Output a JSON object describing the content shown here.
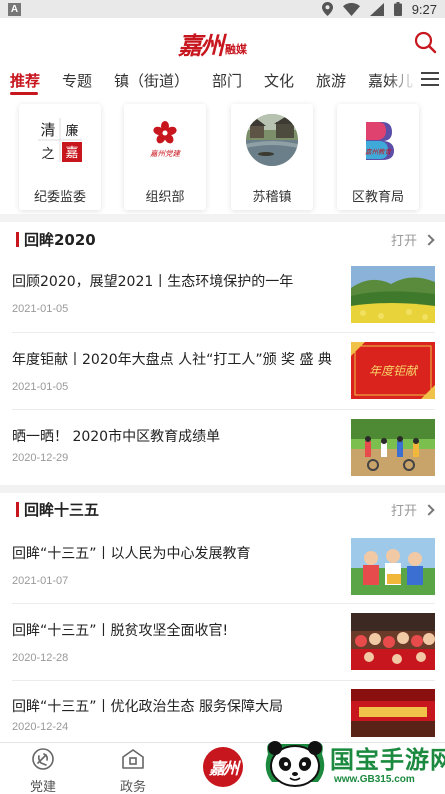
{
  "status_bar": {
    "notification_letter": "A",
    "time": "9:27"
  },
  "header": {
    "logo_text": "嘉州",
    "logo_sub": "融媒"
  },
  "tabs": [
    "推荐",
    "专题",
    "镇（街道）",
    "部门",
    "文化",
    "旅游",
    "嘉妹儿"
  ],
  "shortcuts": [
    {
      "label": "纪委监委",
      "icon_text": [
        "清",
        "廉",
        "之",
        "嘉"
      ]
    },
    {
      "label": "组织部",
      "icon_text": "嘉州党建"
    },
    {
      "label": "苏稽镇"
    },
    {
      "label": "区教育局",
      "icon_text": "嘉州教育"
    }
  ],
  "sections": [
    {
      "title": "回眸2020",
      "open_label": "打开",
      "articles": [
        {
          "title": "回顾2020，展望2021丨生态环境保护的一年",
          "date": "2021-01-05",
          "thumb": "landscape-thumb"
        },
        {
          "title": "年度钜献丨2020年大盘点 人社“打工人”颁 奖 盛 典",
          "date": "2021-01-05",
          "thumb": "award-thumb",
          "thumb_text": "年度钜献"
        },
        {
          "title": "晒一晒！ 2020市中区教育成绩单",
          "date": "2020-12-29",
          "thumb": "school-thumb"
        }
      ]
    },
    {
      "title": "回眸十三五",
      "open_label": "打开",
      "articles": [
        {
          "title": "回眸“十三五”丨以人民为中心发展教育",
          "date": "2021-01-07",
          "thumb": "children-thumb"
        },
        {
          "title": "回眸“十三五”丨脱贫攻坚全面收官!",
          "date": "2020-12-28",
          "thumb": "crowd-thumb"
        },
        {
          "title": "回眸“十三五”丨优化政治生态 服务保障大局",
          "date": "2020-12-24",
          "thumb": "meeting-thumb"
        }
      ]
    }
  ],
  "bottom_nav": [
    {
      "label": "党建",
      "icon": "party-emblem-icon"
    },
    {
      "label": "政务",
      "icon": "government-icon"
    },
    {
      "label": "",
      "icon": "jiazhou-logo-icon",
      "text": "嘉州"
    }
  ],
  "watermark": {
    "text": "国宝手游网",
    "url": "www.GB315.com"
  },
  "colors": {
    "accent": "#c8161e",
    "watermark": "#1b8a3f"
  }
}
